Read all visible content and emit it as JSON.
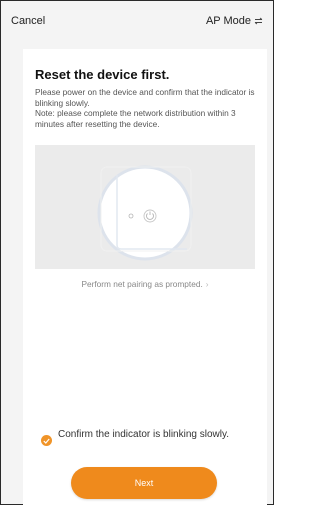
{
  "header": {
    "cancel_label": "Cancel",
    "mode_label": "AP Mode",
    "mode_icon": "swap-icon"
  },
  "main": {
    "title": "Reset the device first.",
    "instruction_lines": [
      "Please power on the device and confirm that the indicator is blinking slowly.",
      "Note: please complete the network distribution within 3 minutes after resetting the device."
    ],
    "illustration_icon": "device-power-button-illustration",
    "pairing_link": "Perform net pairing as prompted.",
    "pairing_link_icon": "chevron-right-icon"
  },
  "footer": {
    "confirm_checked": true,
    "confirm_label": "Confirm the indicator is blinking slowly.",
    "next_label": "Next"
  },
  "colors": {
    "accent": "#ef8a1c",
    "background": "#f4f4f4",
    "illustration_bg": "#ebebeb"
  }
}
